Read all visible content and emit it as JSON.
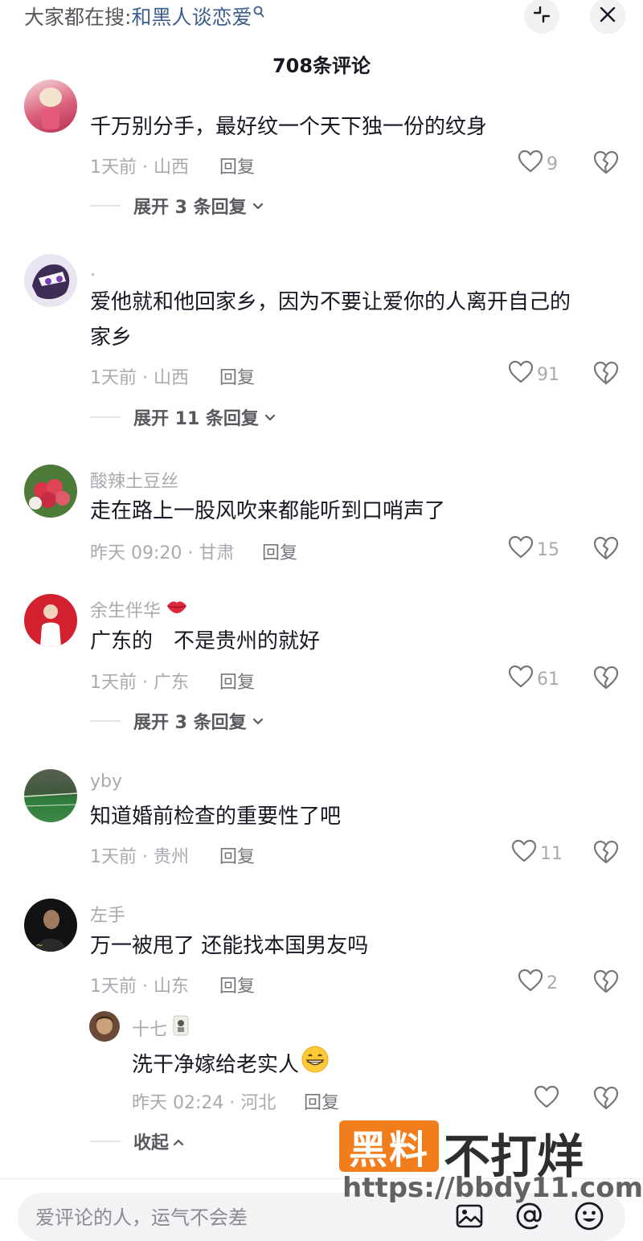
{
  "header": {
    "search_prefix": "大家都在搜:",
    "search_term": "和黑人谈恋爱",
    "comment_count": "708条评论"
  },
  "comments": [
    {
      "username": "",
      "text_lines": [
        "千万别分手，最好纹一个天下独一份的纹身"
      ],
      "meta": "1天前 · 山西",
      "reply_label": "回复",
      "likes": "9",
      "expand": "展开 3 条回复"
    },
    {
      "username": ".",
      "text_lines": [
        "爱他就和他回家乡，因为不要让爱你的人离开自己的",
        "家乡"
      ],
      "meta": "1天前 · 山西",
      "reply_label": "回复",
      "likes": "91",
      "expand": "展开 11 条回复"
    },
    {
      "username": "酸辣土豆丝",
      "text_lines": [
        "走在路上一股风吹来都能听到口哨声了"
      ],
      "meta": "昨天 09:20 · 甘肃",
      "reply_label": "回复",
      "likes": "15"
    },
    {
      "username": "余生伴华",
      "text_lines": [
        "广东的　不是贵州的就好"
      ],
      "meta": "1天前 · 广东",
      "reply_label": "回复",
      "likes": "61",
      "expand": "展开 3 条回复"
    },
    {
      "username": "yby",
      "text_lines": [
        "知道婚前检查的重要性了吧"
      ],
      "meta": "1天前 · 贵州",
      "reply_label": "回复",
      "likes": "11"
    },
    {
      "username": "左手",
      "text_lines": [
        "万一被甩了 还能找本国男友吗"
      ],
      "meta": "1天前 · 山东",
      "reply_label": "回复",
      "likes": "2"
    }
  ],
  "sub_reply": {
    "username": "十七",
    "text": "洗干净嫁给老实人",
    "meta": "昨天 02:24 · 河北",
    "reply_label": "回复",
    "likes": "",
    "collapse": "收起"
  },
  "input": {
    "placeholder": "爱评论的人，运气不会差"
  },
  "watermark": {
    "box_text": "黑料",
    "text": "不打烊",
    "url": "https://bbdy11.com"
  },
  "colors": {
    "background": "#ffffff",
    "text_primary": "#161823",
    "text_secondary": "#a9aab0",
    "search_term": "#3d5d8c",
    "watermark_orange": "#f27d1d"
  },
  "icons": {
    "search": "search-icon",
    "shrink": "shrink-icon",
    "close": "close-icon",
    "like": "heart-icon",
    "dislike": "broken-heart-icon",
    "chevron": "chevron-down-icon",
    "image": "image-icon",
    "mention": "at-icon",
    "emoji": "emoji-icon"
  }
}
